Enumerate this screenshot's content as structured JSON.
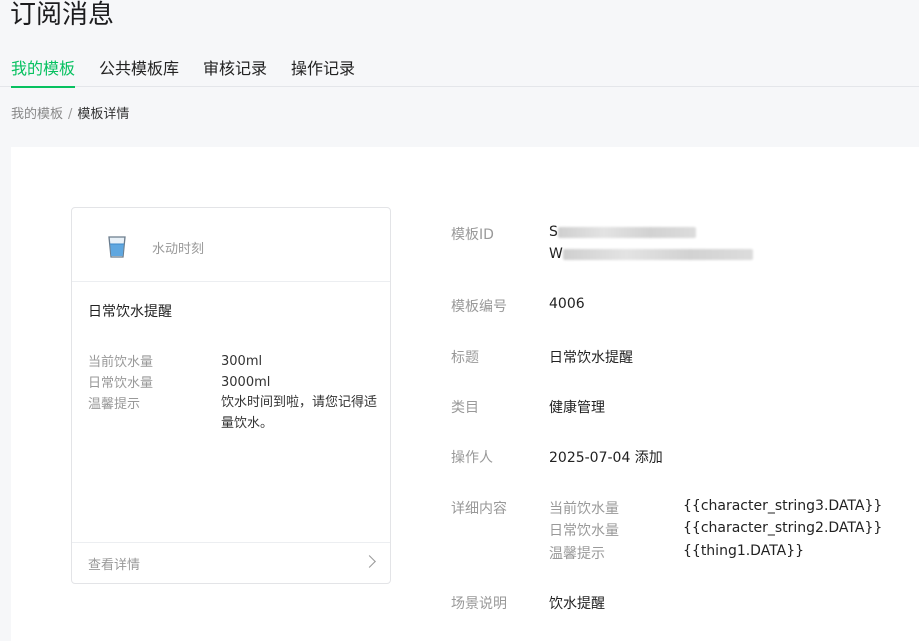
{
  "page": {
    "title": "订阅消息"
  },
  "tabs": [
    {
      "label": "我的模板",
      "active": true
    },
    {
      "label": "公共模板库",
      "active": false
    },
    {
      "label": "审核记录",
      "active": false
    },
    {
      "label": "操作记录",
      "active": false
    }
  ],
  "breadcrumb": {
    "parent": "我的模板",
    "separator": "/",
    "current": "模板详情"
  },
  "preview": {
    "app_name": "水动时刻",
    "icon": "water-glass-icon",
    "title": "日常饮水提醒",
    "fields": [
      {
        "key": "当前饮水量",
        "value": "300ml"
      },
      {
        "key": "日常饮水量",
        "value": "3000ml"
      },
      {
        "key": "温馨提示",
        "value": "饮水时间到啦，请您记得适量饮水。"
      }
    ],
    "footer_label": "查看详情"
  },
  "details": {
    "template_id_label": "模板ID",
    "template_id_line1": "S",
    "template_id_line2": "W",
    "template_no_label": "模板编号",
    "template_no": "4006",
    "title_label": "标题",
    "title": "日常饮水提醒",
    "category_label": "类目",
    "category": "健康管理",
    "operator_label": "操作人",
    "operator": "2025-07-04 添加",
    "content_label": "详细内容",
    "content": [
      {
        "key": "当前饮水量",
        "value": "{{character_string3.DATA}}"
      },
      {
        "key": "日常饮水量",
        "value": "{{character_string2.DATA}}"
      },
      {
        "key": "温馨提示",
        "value": "{{thing1.DATA}}"
      }
    ],
    "scene_label": "场景说明",
    "scene": "饮水提醒"
  },
  "colors": {
    "accent": "#07c160",
    "background": "#f6f7f9"
  }
}
